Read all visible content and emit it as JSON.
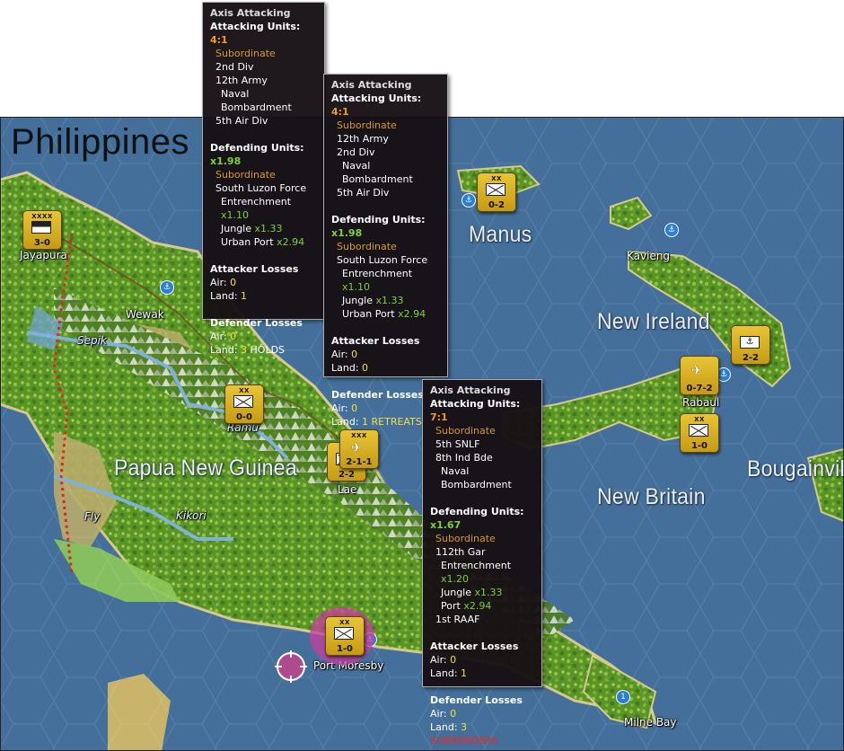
{
  "map": {
    "title": "Philippines",
    "labels": {
      "jayapura": "Jayapura",
      "wewak": "Wewak",
      "sepik": "Sepik",
      "ramu": "Ramu",
      "fly": "Fly",
      "kikori": "Kikori",
      "papua": "Papua New Guinea",
      "lae": "Lae",
      "manus": "Manus",
      "kavieng": "Kavieng",
      "new_ireland": "New Ireland",
      "new_britain": "New Britain",
      "bougainville": "Bougainvill",
      "rabaul": "Rabaul",
      "port_moresby": "Port Moresby",
      "milne_bay": "Milne Bay"
    },
    "badge_numeral": "1",
    "colors": {
      "sea": "#3f6b96",
      "jungle": "#5f9a2a",
      "grassland": "#b8ab6a",
      "counter": "#d9b425",
      "border_dotted": "#e0241c",
      "target": "#b04a8f"
    }
  },
  "counters": {
    "jayapura": {
      "echelon": "XXXX",
      "strength": "3-0",
      "icon": "hq-icon"
    },
    "manus": {
      "echelon": "XX",
      "strength": "0-2",
      "icon": "infantry-icon"
    },
    "ramu": {
      "echelon": "XX",
      "strength": "0-0",
      "icon": "infantry-icon"
    },
    "lae_air": {
      "echelon": "XXX",
      "strength": "2-1-1",
      "icon": "aircraft-icon"
    },
    "lae_inf": {
      "echelon": "",
      "strength": "2-2",
      "icon": "infantry-icon"
    },
    "new_ireland": {
      "echelon": "",
      "strength": "2-2",
      "icon": "anchor-icon"
    },
    "rabaul_air": {
      "echelon": "",
      "strength": "0-7-2",
      "icon": "aircraft-icon"
    },
    "rabaul_inf": {
      "echelon": "XX",
      "strength": "1-0",
      "icon": "infantry-icon"
    },
    "port_moresby": {
      "echelon": "XX",
      "strength": "1-0",
      "icon": "infantry-icon"
    }
  },
  "panels": [
    {
      "header": "Axis Attacking",
      "attacking_label": "Attacking Units:",
      "odds": "4:1",
      "att_sub": "Subordinate",
      "att_units": [
        "2nd Div",
        "12th Army"
      ],
      "att_units_2": [
        "Naval Bombardment"
      ],
      "att_units_3": [
        "5th Air Div"
      ],
      "defending_label": "Defending Units:",
      "def_mult": "x1.98",
      "def_sub": "Subordinate",
      "def_unit": "South Luzon Force",
      "mods": [
        {
          "name": "Entrenchment",
          "val": "x1.10"
        },
        {
          "name": "Jungle",
          "val": "x1.33"
        },
        {
          "name": "Urban Port",
          "val": "x2.94"
        }
      ],
      "att_losses_label": "Attacker Losses",
      "att_air_label": "Air:",
      "att_air": "0",
      "att_land_label": "Land:",
      "att_land": "1",
      "def_losses_label": "Defender Losses",
      "def_air_label": "Air:",
      "def_air": "0",
      "def_land_label": "Land:",
      "def_land": "3",
      "result": "HOLDS"
    },
    {
      "header": "Axis Attacking",
      "attacking_label": "Attacking Units:",
      "odds": "4:1",
      "att_sub": "Subordinate",
      "att_units": [
        "12th Army",
        "2nd Div"
      ],
      "att_units_2": [
        "Naval Bombardment"
      ],
      "att_units_3": [
        "5th Air Div"
      ],
      "defending_label": "Defending Units:",
      "def_mult": "x1.98",
      "def_sub": "Subordinate",
      "def_unit": "South Luzon Force",
      "mods": [
        {
          "name": "Entrenchment",
          "val": "x1.10"
        },
        {
          "name": "Jungle",
          "val": "x1.33"
        },
        {
          "name": "Urban Port",
          "val": "x2.94"
        }
      ],
      "att_losses_label": "Attacker Losses",
      "att_air_label": "Air:",
      "att_air": "0",
      "att_land_label": "Land:",
      "att_land": "0",
      "def_losses_label": "Defender Losses",
      "def_air_label": "Air:",
      "def_air": "0",
      "def_land_label": "Land:",
      "def_land": "1",
      "result": "RETREATS"
    },
    {
      "header": "Axis Attacking",
      "attacking_label": "Attacking Units:",
      "odds": "7:1",
      "att_sub": "Subordinate",
      "att_units": [
        "5th SNLF",
        "8th Ind Bde"
      ],
      "att_units_2": [
        "Naval Bombardment"
      ],
      "defending_label": "Defending Units:",
      "def_mult": "x1.67",
      "def_sub": "Subordinate",
      "def_unit": "112th Gar",
      "mods": [
        {
          "name": "Entrenchment",
          "val": "x1.20"
        },
        {
          "name": "Jungle",
          "val": "x1.33"
        },
        {
          "name": "Port",
          "val": "x2.94"
        }
      ],
      "def_extra": "1st RAAF",
      "att_losses_label": "Attacker Losses",
      "att_air_label": "Air:",
      "att_air": "0",
      "att_land_label": "Land:",
      "att_land": "1",
      "def_losses_label": "Defender Losses",
      "def_air_label": "Air:",
      "def_air": "0",
      "def_land_label": "Land:",
      "def_land": "3",
      "result": "SURRENDERS"
    }
  ]
}
